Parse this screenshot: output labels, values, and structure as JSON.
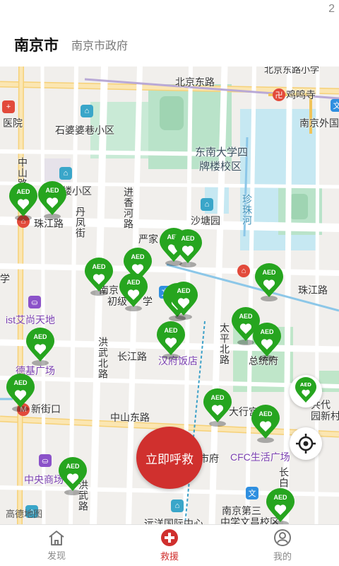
{
  "status": {
    "clock_fragment": "2"
  },
  "header": {
    "city": "南京市",
    "subtitle": "南京市政府"
  },
  "map": {
    "labels": {
      "north_road": "北京东路",
      "north_road2": "北京东路小学",
      "jiming": "鸡鸣寺",
      "hospital": "医院",
      "shipo": "石婆婆巷小区",
      "nanjing_wai": "南京外国",
      "seu": "东南大学四",
      "seu2": "牌楼校区",
      "zhongshan_v": "中山路",
      "xiaoqu": "楼小区",
      "zhujiang": "珠江路",
      "zhujiang2": "珠江路",
      "danfeng": "丹凤街",
      "jinxiang": "进香河路",
      "shatang": "沙塘园",
      "zhenzhu": "珍珠河",
      "yanjia": "严家",
      "nanjing_r": "南京",
      "chuji": "初级",
      "xue": "学",
      "ist": "ist艾尚天地",
      "hongwu": "洪武北路",
      "changjiang": "长江路",
      "taiping": "太平北路",
      "hanfu": "汉府饭店",
      "zongtongfu": "总统府",
      "deji": "德基广场",
      "xinjiekou": "新街口",
      "zhongshan_e": "中山东路",
      "daxing": "大行宫",
      "gongyuan": "共代",
      "yuanxin": "园新村",
      "shifu": "市府",
      "cfc": "CFC生活广场",
      "zhongyang": "中央商场",
      "hongwu_s": "洪武路",
      "changbai": "长白",
      "nanjing_3": "南京第三",
      "wenchang": "中学文昌校区",
      "yuanyuan": "远洋国际中心",
      "xue2": "学",
      "logo": "高德地图"
    },
    "aed_text": "AED",
    "colors": {
      "aed": "#26a51f",
      "call": "#d0302e"
    }
  },
  "call_button": "立即呼救",
  "tabs": [
    {
      "label": "发现",
      "icon": "home-icon"
    },
    {
      "label": "救援",
      "icon": "medical-cross-icon",
      "active": true
    },
    {
      "label": "我的",
      "icon": "user-icon"
    }
  ]
}
